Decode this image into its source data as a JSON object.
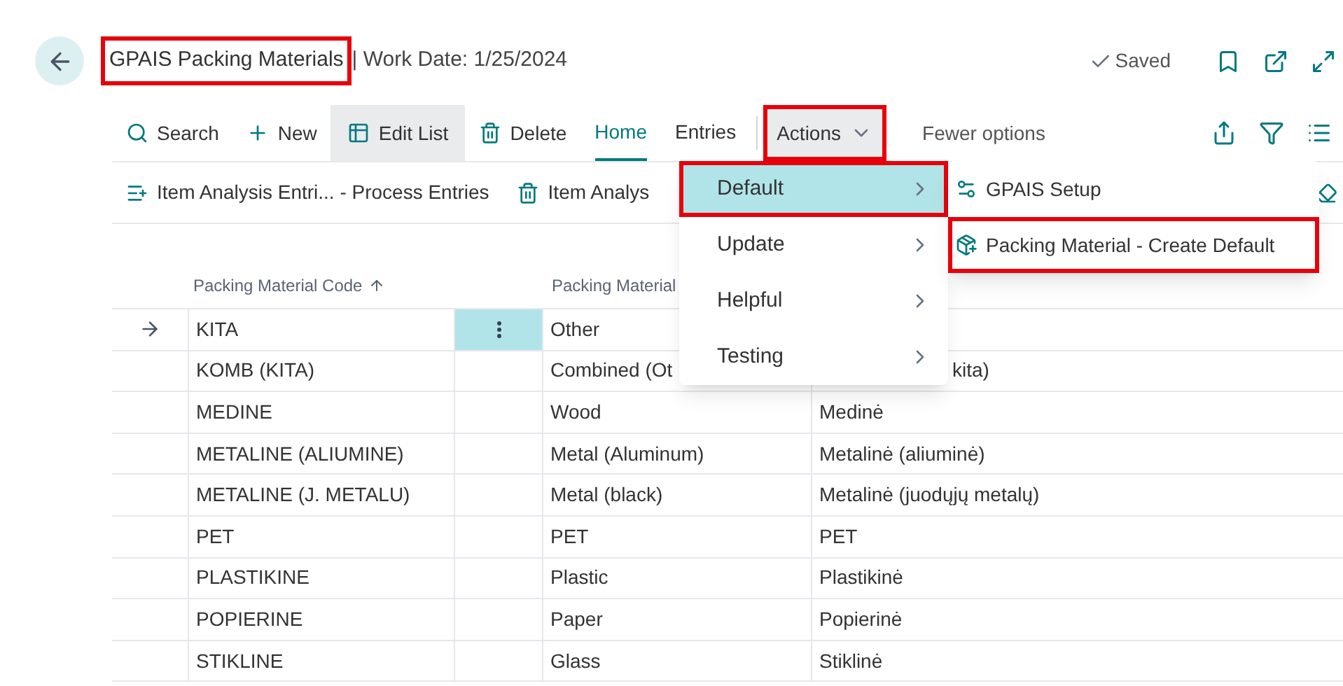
{
  "header": {
    "title": "GPAIS Packing Materials",
    "title_highlighted": true,
    "subtitle": "| Work Date: 1/25/2024",
    "status": "Saved"
  },
  "toolbar": [
    {
      "kind": "search",
      "label": "Search"
    },
    {
      "kind": "new",
      "label": "New"
    },
    {
      "kind": "edit",
      "label": "Edit List",
      "pressed": true
    },
    {
      "kind": "delete",
      "label": "Delete"
    },
    {
      "kind": "tab",
      "label": "Home",
      "selected": true
    },
    {
      "kind": "tab",
      "label": "Entries",
      "selected": false
    },
    {
      "kind": "menu",
      "label": "Actions",
      "expanded": true,
      "highlighted": true
    },
    {
      "kind": "plain",
      "label": "Fewer options"
    }
  ],
  "sub_toolbar": [
    {
      "kind": "process",
      "label": "Item Analysis Entri... - Process Entries"
    },
    {
      "kind": "delete",
      "label": "Item Analys"
    }
  ],
  "actions_menu": [
    {
      "label": "Default",
      "selected": true,
      "highlighted": true
    },
    {
      "label": "Update",
      "selected": false,
      "highlighted": false
    },
    {
      "label": "Helpful",
      "selected": false,
      "highlighted": false
    },
    {
      "label": "Testing",
      "selected": false,
      "highlighted": false
    }
  ],
  "submenu": [
    {
      "kind": "setup",
      "label": "GPAIS Setup",
      "highlighted": false
    },
    {
      "kind": "create",
      "label": "Packing Material - Create Default",
      "highlighted": true
    }
  ],
  "table": {
    "columns": [
      "Packing Material Code",
      "Packing Material"
    ],
    "rows": [
      {
        "selected": true,
        "code": "KITA",
        "type": "Other"
      },
      {
        "selected": false,
        "code": "KOMB (KITA)",
        "type": "Combined (Ot",
        "description": "kita)"
      },
      {
        "selected": false,
        "code": "MEDINE",
        "type": "Wood",
        "description": "Medinė"
      },
      {
        "selected": false,
        "code": "METALINE (ALIUMINE)",
        "type": "Metal (Aluminum)",
        "description": "Metalinė (aliuminė)"
      },
      {
        "selected": false,
        "code": "METALINE (J. METALU)",
        "type": "Metal (black)",
        "description": "Metalinė (juodųjų metalų)"
      },
      {
        "selected": false,
        "code": "PET",
        "type": "PET",
        "description": "PET"
      },
      {
        "selected": false,
        "code": "PLASTIKINE",
        "type": "Plastic",
        "description": "Plastikinė"
      },
      {
        "selected": false,
        "code": "POPIERINE",
        "type": "Paper",
        "description": "Popierinė"
      },
      {
        "selected": false,
        "code": "STIKLINE",
        "type": "Glass",
        "description": "Stiklinė"
      }
    ]
  }
}
